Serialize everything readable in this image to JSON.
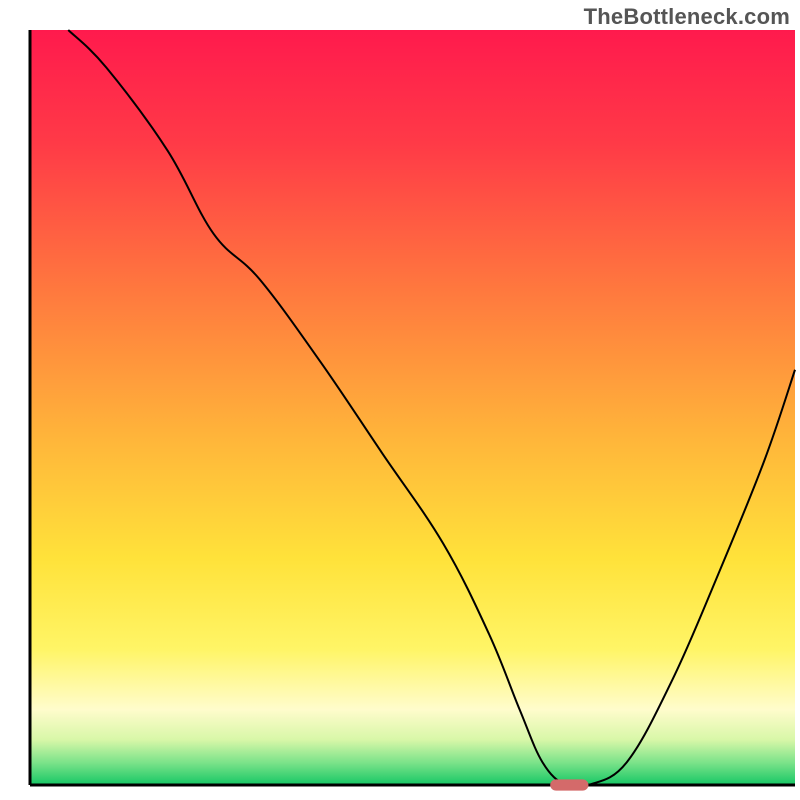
{
  "watermark": "TheBottleneck.com",
  "chart_data": {
    "type": "line",
    "title": "",
    "xlabel": "",
    "ylabel": "",
    "xlim": [
      0,
      100
    ],
    "ylim": [
      0,
      100
    ],
    "background_gradient": {
      "stops": [
        {
          "y_percent": 0,
          "color": "#ff1a4d"
        },
        {
          "y_percent": 15,
          "color": "#ff3a47"
        },
        {
          "y_percent": 35,
          "color": "#ff7a3e"
        },
        {
          "y_percent": 55,
          "color": "#ffb83a"
        },
        {
          "y_percent": 70,
          "color": "#ffe23a"
        },
        {
          "y_percent": 82,
          "color": "#fff566"
        },
        {
          "y_percent": 90,
          "color": "#fffccc"
        },
        {
          "y_percent": 94,
          "color": "#d8f7a8"
        },
        {
          "y_percent": 97,
          "color": "#7de38a"
        },
        {
          "y_percent": 100,
          "color": "#16c765"
        }
      ]
    },
    "series": [
      {
        "name": "valley-curve",
        "color": "#000000",
        "width": 2,
        "x": [
          5,
          10,
          18,
          24,
          30,
          38,
          46,
          54,
          60,
          64,
          67,
          70,
          73,
          78,
          84,
          90,
          96,
          100
        ],
        "y": [
          100,
          95,
          84,
          73,
          67,
          56,
          44,
          32,
          20,
          10,
          3,
          0,
          0,
          3,
          14,
          28,
          43,
          55
        ]
      }
    ],
    "annotations": [
      {
        "name": "bottom-marker",
        "type": "pill",
        "x": 70.5,
        "y": 0,
        "width_pct": 5,
        "height_pct": 1.5,
        "color": "#d46a6a"
      }
    ]
  }
}
